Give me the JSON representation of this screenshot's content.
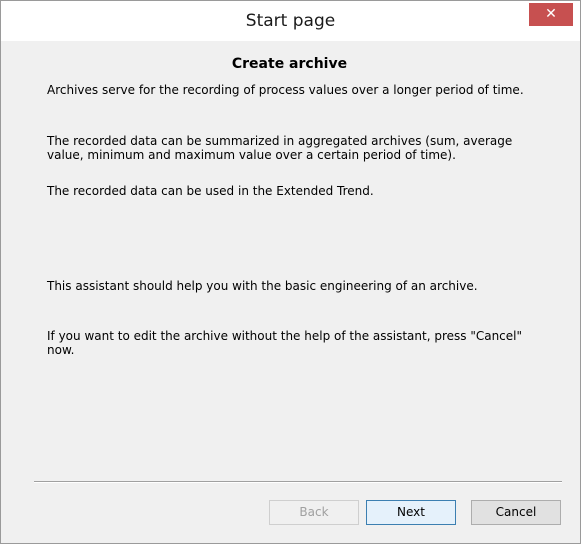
{
  "window": {
    "title": "Start page",
    "close_glyph": "✕"
  },
  "content": {
    "heading": "Create archive",
    "paragraphs": [
      "Archives serve for the recording of process values over a longer period of time.",
      "The recorded data can be summarized in aggregated archives (sum, average value, minimum and maximum value over a certain period of time).",
      "The recorded data can be used in the Extended Trend.",
      "This assistant should help you with the basic engineering of an archive.",
      "If you want to edit the archive without the help of the assistant, press \"Cancel\" now."
    ]
  },
  "buttons": {
    "back": "Back",
    "next": "Next",
    "cancel": "Cancel"
  },
  "colors": {
    "close_button": "#c75050",
    "default_button_border": "#3c7fb1"
  }
}
